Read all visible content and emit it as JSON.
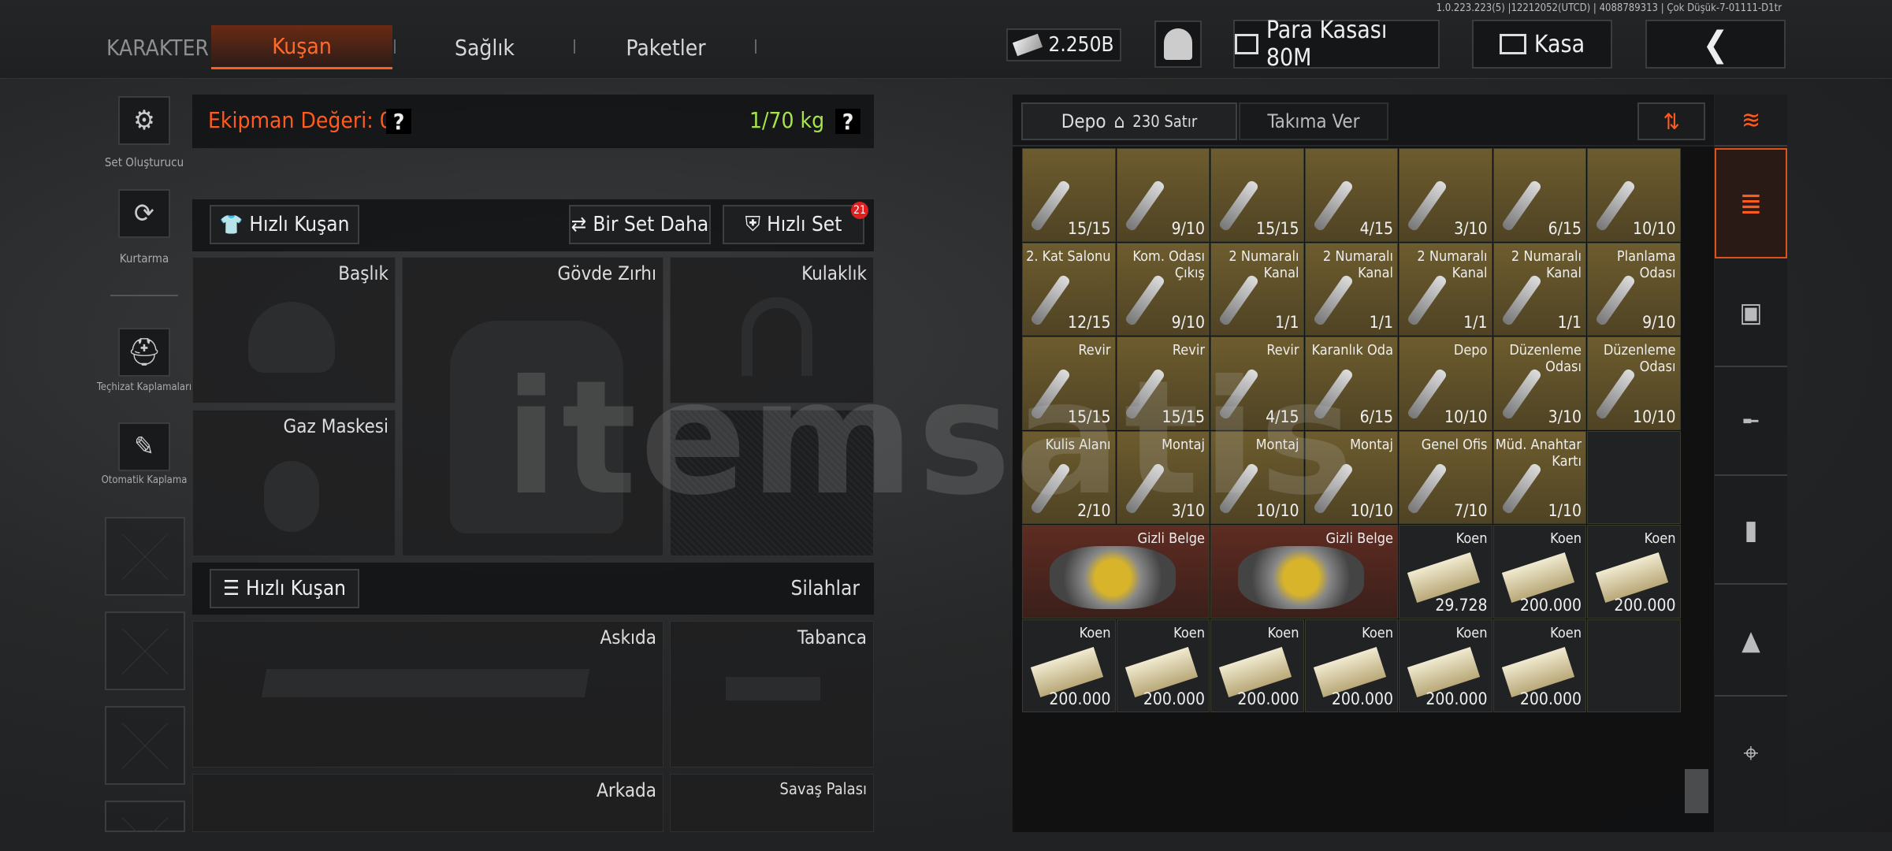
{
  "version_text": "1.0.223.223(5) |12212052(UTCD) | 4088789313 | Çok Düşük-7-01111-D1tr",
  "tabs": {
    "karakter": "KARAKTER",
    "kusan": "Kuşan",
    "saglik": "Sağlık",
    "paketler": "Paketler"
  },
  "currency": {
    "amount": "2.250B"
  },
  "para_kasasi": "Para Kasası 80M",
  "kasa": "Kasa",
  "sidebar": {
    "set_olusturucu": "Set Oluşturucu",
    "kurtarma": "Kurtarma",
    "teghizat": "Teçhizat Kaplamaları",
    "otomatik": "Otomatik Kaplama"
  },
  "equip": {
    "value_label": "Ekipman Değeri: 0",
    "weight": "1/70 kg",
    "q": "?",
    "hizli_kusan": "Hızlı Kuşan",
    "bir_set_daha": "Bir Set Daha",
    "hizli_set": "Hızlı Set",
    "hizli_set_badge": "21",
    "slots": {
      "baslik": "Başlık",
      "govde": "Gövde Zırhı",
      "kulaklik": "Kulaklık",
      "gaz": "Gaz Maskesi"
    },
    "hizli_kusan2": "Hızlı Kuşan",
    "silahlar": "Silahlar",
    "weapons": {
      "askida": "Askıda",
      "tabanca": "Tabanca",
      "arkada": "Arkada",
      "savas": "Savaş Palası"
    }
  },
  "depot": {
    "depo": "Depo",
    "satir": "230 Satır",
    "takima_ver": "Takıma Ver"
  },
  "grid": [
    [
      {
        "t": "",
        "c": "15/15",
        "k": "gold"
      },
      {
        "t": "",
        "c": "9/10",
        "k": "gold"
      },
      {
        "t": "",
        "c": "15/15",
        "k": "gold"
      },
      {
        "t": "",
        "c": "4/15",
        "k": "gold"
      },
      {
        "t": "",
        "c": "3/10",
        "k": "gold"
      },
      {
        "t": "",
        "c": "6/15",
        "k": "gold"
      },
      {
        "t": "",
        "c": "10/10",
        "k": "gold"
      }
    ],
    [
      {
        "t": "2. Kat Salonu",
        "c": "12/15",
        "k": "gold"
      },
      {
        "t": "Kom. Odası Çıkış",
        "c": "9/10",
        "k": "gold"
      },
      {
        "t": "2 Numaralı Kanal",
        "c": "1/1",
        "k": "gold"
      },
      {
        "t": "2 Numaralı Kanal",
        "c": "1/1",
        "k": "gold"
      },
      {
        "t": "2 Numaralı Kanal",
        "c": "1/1",
        "k": "gold"
      },
      {
        "t": "2 Numaralı Kanal",
        "c": "1/1",
        "k": "gold"
      },
      {
        "t": "Planlama Odası",
        "c": "9/10",
        "k": "gold"
      }
    ],
    [
      {
        "t": "Revir",
        "c": "15/15",
        "k": "gold"
      },
      {
        "t": "Revir",
        "c": "15/15",
        "k": "gold"
      },
      {
        "t": "Revir",
        "c": "4/15",
        "k": "gold"
      },
      {
        "t": "Karanlık Oda",
        "c": "6/15",
        "k": "gold"
      },
      {
        "t": "Depo",
        "c": "10/10",
        "k": "gold"
      },
      {
        "t": "Düzenleme Odası",
        "c": "3/10",
        "k": "gold"
      },
      {
        "t": "Düzenleme Odası",
        "c": "10/10",
        "k": "gold"
      }
    ],
    [
      {
        "t": "Kulis Alanı",
        "c": "2/10",
        "k": "gold"
      },
      {
        "t": "Montaj",
        "c": "3/10",
        "k": "gold"
      },
      {
        "t": "Montaj",
        "c": "10/10",
        "k": "gold"
      },
      {
        "t": "Montaj",
        "c": "10/10",
        "k": "gold"
      },
      {
        "t": "Genel Ofis",
        "c": "7/10",
        "k": "gold"
      },
      {
        "t": "Müd. Anahtar Kartı",
        "c": "1/10",
        "k": "gold"
      },
      {
        "t": "",
        "c": "",
        "k": "dark"
      }
    ],
    [
      {
        "t": "Gizli Belge",
        "c": "",
        "k": "red",
        "w": 2
      },
      {
        "t": "Gizli Belge",
        "c": "",
        "k": "red",
        "w": 2
      },
      {
        "t": "Koen",
        "c": "29.728",
        "k": "dark"
      },
      {
        "t": "Koen",
        "c": "200.000",
        "k": "dark"
      },
      {
        "t": "Koen",
        "c": "200.000",
        "k": "dark"
      }
    ],
    [
      {
        "t": "Koen",
        "c": "200.000",
        "k": "dark"
      },
      {
        "t": "Koen",
        "c": "200.000",
        "k": "dark"
      },
      {
        "t": "Koen",
        "c": "200.000",
        "k": "dark"
      },
      {
        "t": "Koen",
        "c": "200.000",
        "k": "dark"
      },
      {
        "t": "Koen",
        "c": "200.000",
        "k": "dark"
      },
      {
        "t": "Koen",
        "c": "200.000",
        "k": "dark"
      },
      {
        "t": "",
        "c": "",
        "k": "dark"
      }
    ]
  ],
  "watermark": "itemsatis"
}
